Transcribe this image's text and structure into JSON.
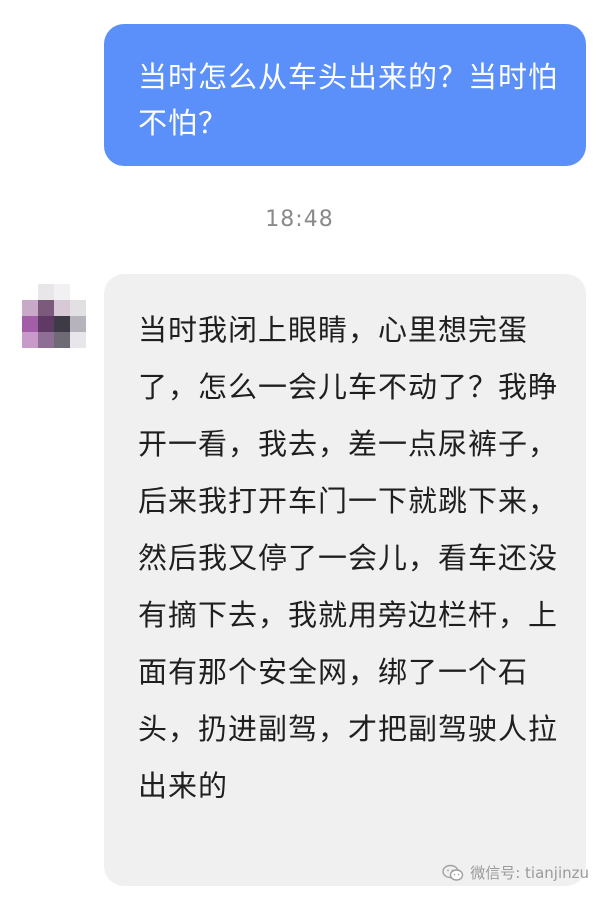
{
  "chat": {
    "outgoing_message": "当时怎么从车头出来的？当时怕不怕？",
    "timestamp": "18:48",
    "incoming_message": "当时我闭上眼睛，心里想完蛋了，怎么一会儿车不动了？我睁开一看，我去，差一点尿裤子，后来我打开车门一下就跳下来，然后我又停了一会儿，看车还没有摘下去，我就用旁边栏杆，上面有那个安全网，绑了一个石头，扔进副驾，才把副驾驶人拉出来的"
  },
  "watermark": {
    "text": "微信号: tianjinzu",
    "icon": "wechat-icon"
  },
  "colors": {
    "outgoing_bubble": "#5b8ff9",
    "incoming_bubble": "#f0f0f0",
    "timestamp_text": "#8a8a8a"
  }
}
